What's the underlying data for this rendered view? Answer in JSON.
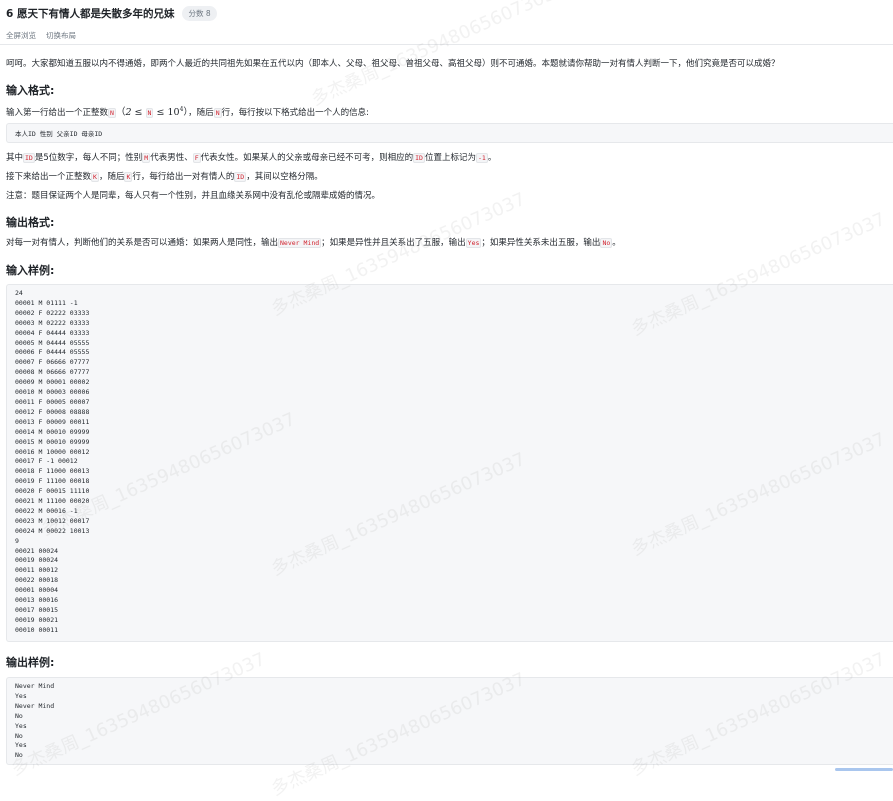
{
  "header": {
    "title": "6 愿天下有情人都是失散多年的兄妹",
    "score": "分数 8",
    "links": [
      "全屏浏览",
      "切换布局"
    ]
  },
  "problem": {
    "intro": "呵呵。大家都知道五服以内不得通婚，即两个人最近的共同祖先如果在五代以内（即本人、父母、祖父母、曾祖父母、高祖父母）则不可通婚。本题就请你帮助一对有情人判断一下，他们究竟是否可以成婚？",
    "input_heading": "输入格式:",
    "input_line1_a": "输入第一行给出一个正整数",
    "input_line1_code_n": "N",
    "input_line1_math_open": "（",
    "input_line1_math_2": "2",
    "input_line1_math_le": "≤",
    "input_line1_math_10": "10",
    "input_line1_math_4": "4",
    "input_line1_math_close": "）",
    "input_line1_b": "，随后",
    "input_line1_c": "行，每行按以下格式给出一个人的信息:",
    "format_line": "本人ID 性别 父亲ID 母亲ID",
    "desc1_a": "其中",
    "desc1_code_id": "ID",
    "desc1_b": "是5位数字，每人不同；性别",
    "desc1_code_m": "M",
    "desc1_c": "代表男性、",
    "desc1_code_f": "F",
    "desc1_d": "代表女性。如果某人的父亲或母亲已经不可考，则相应的",
    "desc1_e": "位置上标记为",
    "desc1_code_neg": "-1",
    "desc1_f": "。",
    "desc2_a": "接下来给出一个正整数",
    "desc2_code_k": "K",
    "desc2_b": "，随后",
    "desc2_c": "行，每行给出一对有情人的",
    "desc2_d": "，其间以空格分隔。",
    "note": "注意：题目保证两个人是同辈，每人只有一个性别，并且血缘关系网中没有乱伦或隔辈成婚的情况。",
    "output_heading": "输出格式:",
    "output_a": "对每一对有情人，判断他们的关系是否可以通婚：如果两人是同性，输出",
    "output_code_nm": "Never Mind",
    "output_b": "；如果是异性并且关系出了五服，输出",
    "output_code_yes": "Yes",
    "output_c": "；如果异性关系未出五服，输出",
    "output_code_no": "No",
    "output_d": "。",
    "sample_in_heading": "输入样例:",
    "sample_in": "24\n00001 M 01111 -1\n00002 F 02222 03333\n00003 M 02222 03333\n00004 F 04444 03333\n00005 M 04444 05555\n00006 F 04444 05555\n00007 F 06666 07777\n00008 M 06666 07777\n00009 M 00001 00002\n00010 M 00003 00006\n00011 F 00005 00007\n00012 F 00008 08888\n00013 F 00009 00011\n00014 M 00010 09999\n00015 M 00010 09999\n00016 M 10000 00012\n00017 F -1 00012\n00018 F 11000 00013\n00019 F 11100 00018\n00020 F 00015 11110\n00021 M 11100 00020\n00022 M 00016 -1\n00023 M 10012 00017\n00024 M 00022 10013\n9\n00021 00024\n00019 00024\n00011 00012\n00022 00018\n00001 00004\n00013 00016\n00017 00015\n00019 00021\n00010 00011",
    "sample_out_heading": "输出样例:",
    "sample_out": "Never Mind\nYes\nNever Mind\nNo\nYes\nNo\nYes\nNo"
  },
  "watermark": "多杰桑周_16359480656073037"
}
